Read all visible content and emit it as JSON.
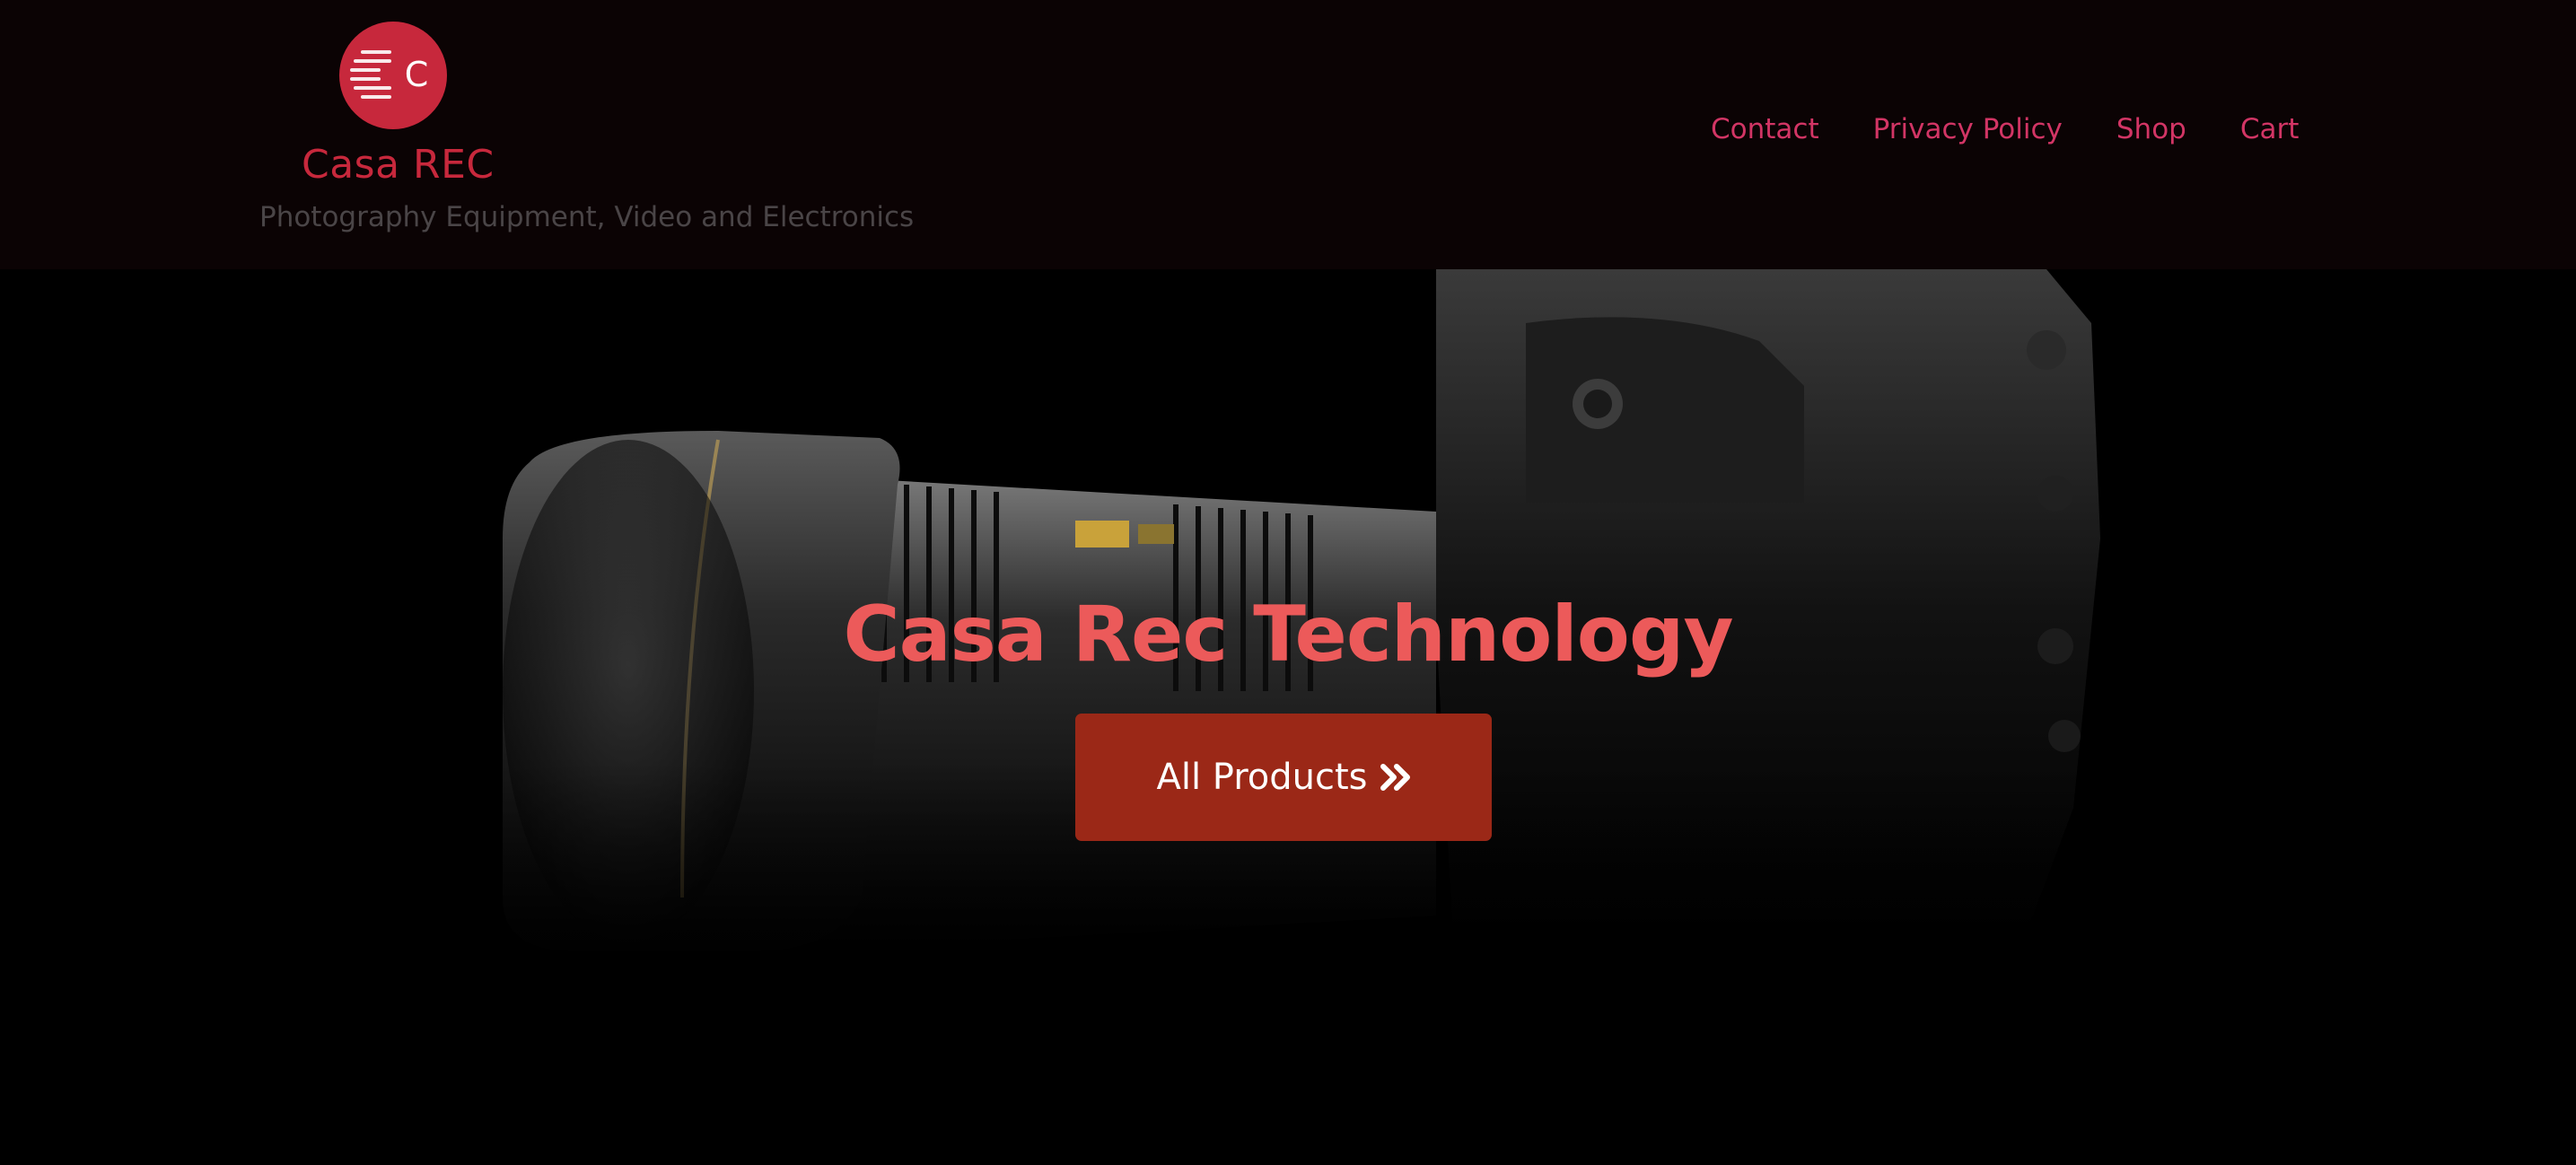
{
  "header": {
    "site_title": "Casa REC",
    "tagline": "Photography Equipment, Video and Electronics",
    "logo_letter": "C",
    "logo_icon": "casa-rec-logo-icon",
    "brand_color": "#c7283c"
  },
  "nav": {
    "items": [
      {
        "label": "Contact"
      },
      {
        "label": "Privacy Policy"
      },
      {
        "label": "Shop"
      },
      {
        "label": "Cart"
      }
    ],
    "link_color": "#d23565"
  },
  "hero": {
    "title": "Casa Rec Technology",
    "title_color": "#ec5a5a",
    "background_image": "camera-lens-dark-photo",
    "cta": {
      "label": "All Products",
      "icon": "double-chevron-right-icon",
      "color": "#9b2817"
    }
  }
}
